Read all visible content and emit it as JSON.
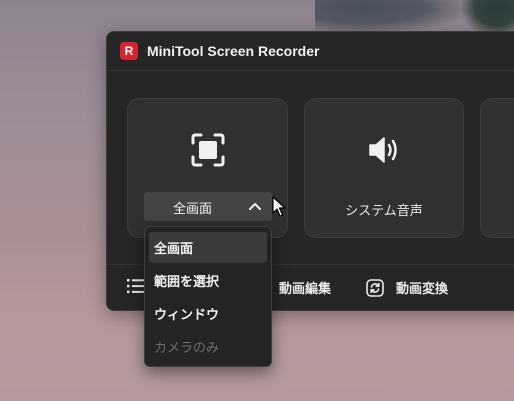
{
  "window": {
    "title": "MiniTool Screen Recorder",
    "logo_letter": "R"
  },
  "cards": {
    "screen": {
      "icon": "fullscreen-capture-icon",
      "mode_selected": "全画面"
    },
    "audio": {
      "icon": "speaker-icon",
      "label": "システム音声"
    }
  },
  "toolbar": {
    "list_icon": "list-icon",
    "edit_label": "動画編集",
    "convert_icon": "refresh-icon",
    "convert_label": "動画変換"
  },
  "mode_menu": {
    "items": [
      {
        "label": "全画面",
        "selected": true,
        "enabled": true
      },
      {
        "label": "範囲を選択",
        "selected": false,
        "enabled": true
      },
      {
        "label": "ウィンドウ",
        "selected": false,
        "enabled": true
      },
      {
        "label": "カメラのみ",
        "selected": false,
        "enabled": false
      }
    ]
  },
  "colors": {
    "brand": "#d6232f",
    "window_bg": "#262626",
    "card_bg": "#303030",
    "selector_bg": "#444444"
  }
}
